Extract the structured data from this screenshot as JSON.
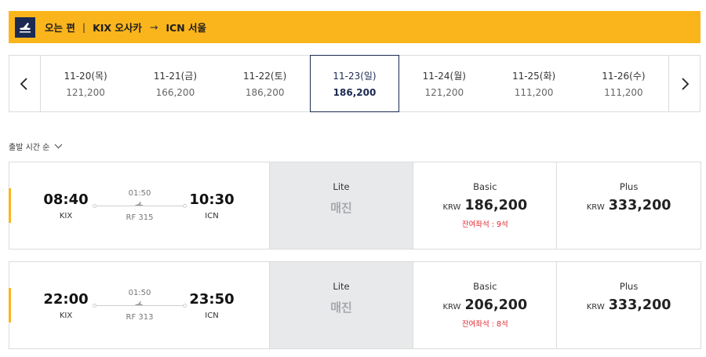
{
  "header": {
    "direction": "오는 편",
    "origin": "KIX 오사카",
    "arrow": "→",
    "destination": "ICN 서울",
    "accent": "#fbb51c",
    "icon": "plane-landing-icon"
  },
  "dates": [
    {
      "label": "11-20(목)",
      "price": "121,200"
    },
    {
      "label": "11-21(금)",
      "price": "166,200"
    },
    {
      "label": "11-22(토)",
      "price": "186,200"
    },
    {
      "label": "11-23(일)",
      "price": "186,200",
      "selected": true
    },
    {
      "label": "11-24(월)",
      "price": "121,200"
    },
    {
      "label": "11-25(화)",
      "price": "111,200"
    },
    {
      "label": "11-26(수)",
      "price": "111,200"
    }
  ],
  "sort": {
    "label": "출발 시간 순"
  },
  "flights": [
    {
      "dep_time": "08:40",
      "dep_code": "KIX",
      "arr_time": "10:30",
      "arr_code": "ICN",
      "duration": "01:50",
      "flight_no": "RF 315",
      "lite": {
        "name": "Lite",
        "status": "매진"
      },
      "basic": {
        "name": "Basic",
        "currency": "KRW",
        "amount": "186,200",
        "seats": "잔여좌석 : 9석"
      },
      "plus": {
        "name": "Plus",
        "currency": "KRW",
        "amount": "333,200"
      }
    },
    {
      "dep_time": "22:00",
      "dep_code": "KIX",
      "arr_time": "23:50",
      "arr_code": "ICN",
      "duration": "01:50",
      "flight_no": "RF 313",
      "lite": {
        "name": "Lite",
        "status": "매진"
      },
      "basic": {
        "name": "Basic",
        "currency": "KRW",
        "amount": "206,200",
        "seats": "잔여좌석 : 8석"
      },
      "plus": {
        "name": "Plus",
        "currency": "KRW",
        "amount": "333,200"
      }
    }
  ]
}
